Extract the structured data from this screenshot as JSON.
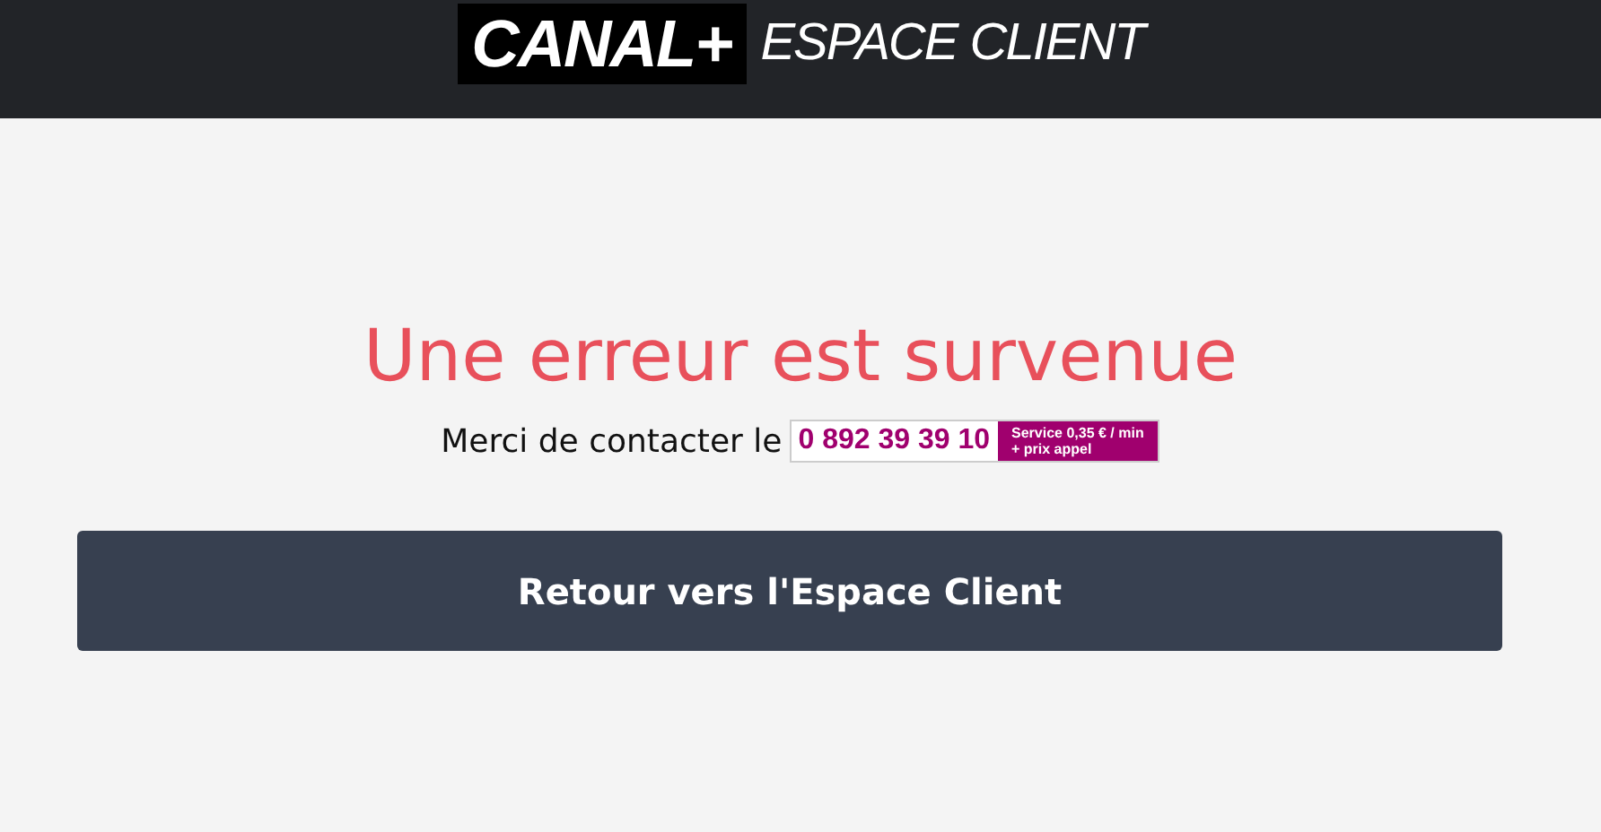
{
  "header": {
    "logo": "CANAL+",
    "subtitle": "ESPACE CLIENT"
  },
  "error": {
    "title": "Une erreur est survenue",
    "message": "Merci de contacter le",
    "phone": {
      "number": "0 892 39 39 10",
      "tariff_line_1": "Service 0,35 € / min",
      "tariff_line_2": "+ prix appel"
    }
  },
  "button": {
    "label": "Retour vers l'Espace Client"
  }
}
